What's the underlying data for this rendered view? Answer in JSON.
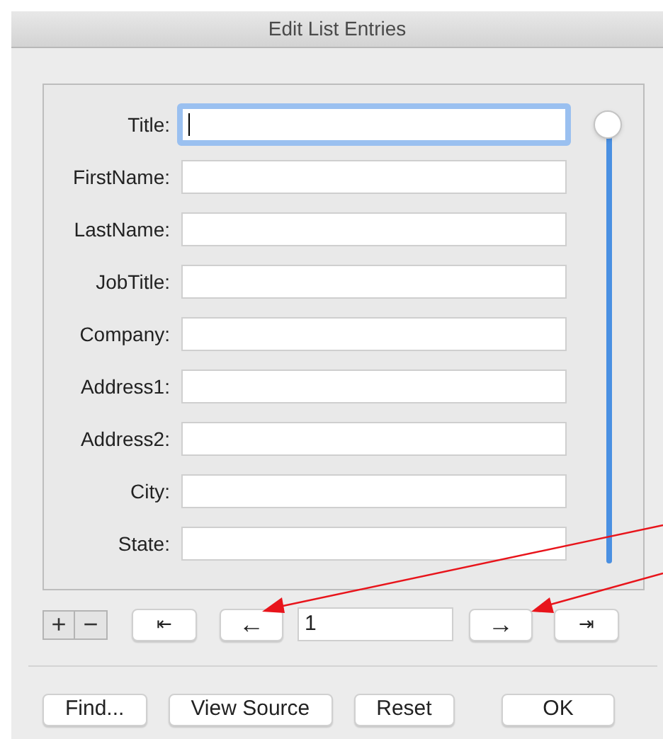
{
  "window": {
    "title": "Edit List Entries"
  },
  "fields": [
    {
      "label": "Title:",
      "focused": true
    },
    {
      "label": "FirstName:",
      "focused": false
    },
    {
      "label": "LastName:",
      "focused": false
    },
    {
      "label": "JobTitle:",
      "focused": false
    },
    {
      "label": "Company:",
      "focused": false
    },
    {
      "label": "Address1:",
      "focused": false
    },
    {
      "label": "Address2:",
      "focused": false
    },
    {
      "label": "City:",
      "focused": false
    },
    {
      "label": "State:",
      "focused": false
    }
  ],
  "scroll_slider": {
    "level": 1
  },
  "navigation": {
    "add": "+",
    "remove": "−",
    "first": "⇤",
    "previous": "←",
    "record": "1",
    "next": "→",
    "last": "⇥"
  },
  "buttons": [
    {
      "label": "Find...",
      "kind": "left"
    },
    {
      "label": "View Source",
      "kind": "left"
    },
    {
      "label": "Reset",
      "kind": "left"
    },
    {
      "label": "OK",
      "kind": "right"
    }
  ]
}
